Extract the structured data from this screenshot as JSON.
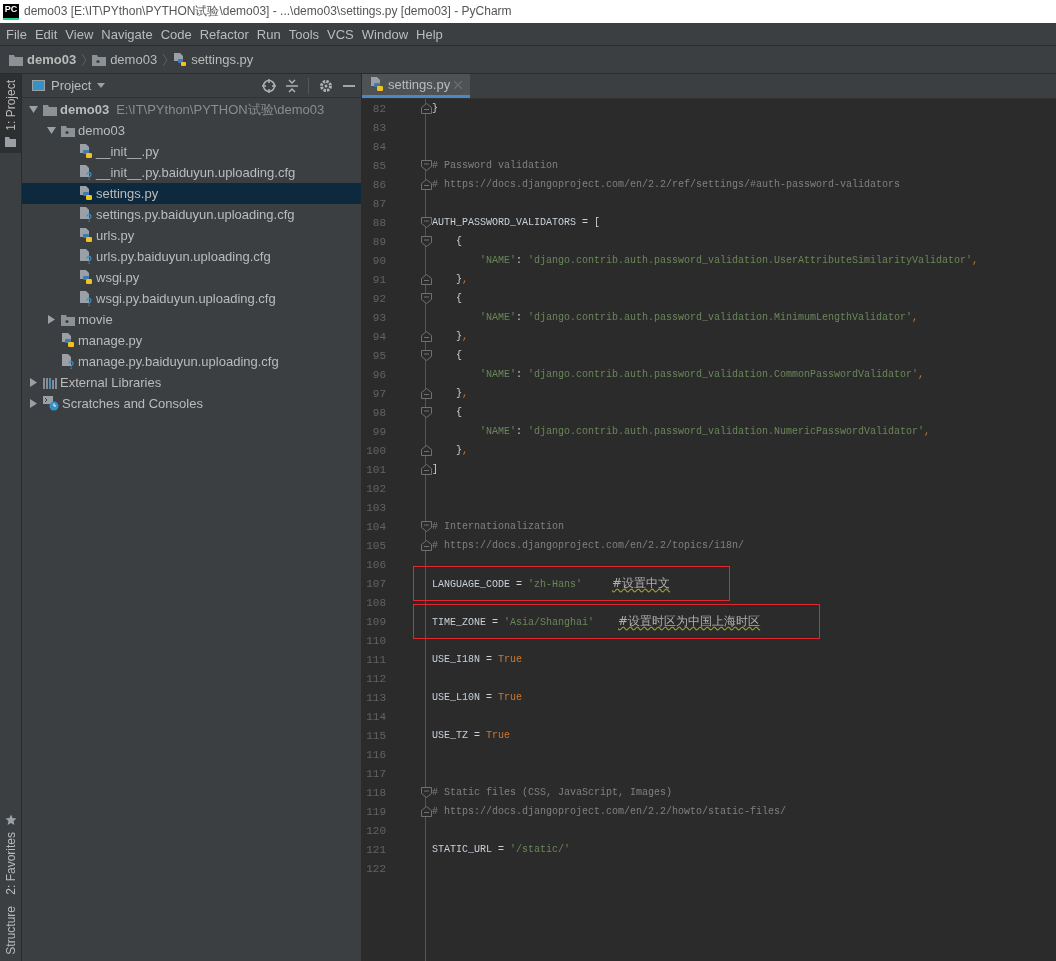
{
  "window": {
    "logo_text": "PC",
    "title": "demo03 [E:\\IT\\PYthon\\PYTHON试验\\demo03] - ...\\demo03\\settings.py [demo03] - PyCharm"
  },
  "menu": [
    "File",
    "Edit",
    "View",
    "Navigate",
    "Code",
    "Refactor",
    "Run",
    "Tools",
    "VCS",
    "Window",
    "Help"
  ],
  "breadcrumb": [
    {
      "label": "demo03",
      "kind": "folder"
    },
    {
      "label": "demo03",
      "kind": "package"
    },
    {
      "label": "settings.py",
      "kind": "python"
    }
  ],
  "side_stripe": {
    "top": [
      {
        "label": "1: Project",
        "selected": true
      }
    ],
    "bottom": [
      {
        "label": "2: Favorites",
        "selected": false
      },
      {
        "label": "Structure",
        "selected": false
      }
    ]
  },
  "project": {
    "title": "Project",
    "tree": [
      {
        "name": "demo03",
        "path": "E:\\IT\\PYthon\\PYTHON试验\\demo03",
        "kind": "folder",
        "expanded": true,
        "selected": false,
        "children": [
          {
            "name": "demo03",
            "kind": "package",
            "expanded": true,
            "selected": false,
            "children": [
              {
                "name": "__init__.py",
                "kind": "python",
                "selected": false
              },
              {
                "name": "__init__.py.baiduyun.uploading.cfg",
                "kind": "cfg",
                "selected": false
              },
              {
                "name": "settings.py",
                "kind": "python",
                "selected": true
              },
              {
                "name": "settings.py.baiduyun.uploading.cfg",
                "kind": "cfg",
                "selected": false
              },
              {
                "name": "urls.py",
                "kind": "python",
                "selected": false
              },
              {
                "name": "urls.py.baiduyun.uploading.cfg",
                "kind": "cfg",
                "selected": false
              },
              {
                "name": "wsgi.py",
                "kind": "python",
                "selected": false
              },
              {
                "name": "wsgi.py.baiduyun.uploading.cfg",
                "kind": "cfg",
                "selected": false
              }
            ]
          },
          {
            "name": "movie",
            "kind": "package",
            "expanded": false,
            "selected": false
          },
          {
            "name": "manage.py",
            "kind": "python",
            "selected": false
          },
          {
            "name": "manage.py.baiduyun.uploading.cfg",
            "kind": "cfg",
            "selected": false
          }
        ]
      },
      {
        "name": "External Libraries",
        "kind": "libraries",
        "expanded": false,
        "selected": false
      },
      {
        "name": "Scratches and Consoles",
        "kind": "scratches",
        "expanded": false,
        "selected": false
      }
    ]
  },
  "editor": {
    "tabs": [
      {
        "label": "settings.py",
        "selected": true
      }
    ],
    "lines": [
      {
        "number": "82",
        "fold": {
          "kind": "close"
        },
        "boxed": false,
        "tokens": [
          {
            "kind": "plain",
            "text": "}"
          }
        ]
      },
      {
        "number": "83",
        "boxed": false
      },
      {
        "number": "84",
        "boxed": false
      },
      {
        "number": "85",
        "fold": {
          "kind": "open"
        },
        "boxed": false,
        "tokens": [
          {
            "kind": "comment",
            "text": "# Password validation"
          }
        ]
      },
      {
        "number": "86",
        "fold": {
          "kind": "close"
        },
        "boxed": false,
        "tokens": [
          {
            "kind": "comment",
            "text": "# https://docs.djangoproject.com/en/2.2/ref/settings/#auth-password-validators"
          }
        ]
      },
      {
        "number": "87",
        "boxed": false
      },
      {
        "number": "88",
        "fold": {
          "kind": "open"
        },
        "boxed": false,
        "tokens": [
          {
            "kind": "plain",
            "text": "AUTH_PASSWORD_VALIDATORS = ["
          }
        ]
      },
      {
        "number": "89",
        "fold": {
          "kind": "open"
        },
        "boxed": false,
        "tokens": [
          {
            "kind": "plain",
            "text": "    {"
          }
        ]
      },
      {
        "number": "90",
        "boxed": false,
        "tokens": [
          {
            "kind": "string",
            "text": "        'NAME'"
          },
          {
            "kind": "plain",
            "text": ": "
          },
          {
            "kind": "string",
            "text": "'django.contrib.auth.password_validation.UserAttributeSimilarityValidator'"
          },
          {
            "kind": "keyword",
            "text": ","
          }
        ]
      },
      {
        "number": "91",
        "fold": {
          "kind": "close"
        },
        "boxed": false,
        "tokens": [
          {
            "kind": "plain",
            "text": "    }"
          },
          {
            "kind": "keyword",
            "text": ","
          }
        ]
      },
      {
        "number": "92",
        "fold": {
          "kind": "open"
        },
        "boxed": false,
        "tokens": [
          {
            "kind": "plain",
            "text": "    {"
          }
        ]
      },
      {
        "number": "93",
        "boxed": false,
        "tokens": [
          {
            "kind": "string",
            "text": "        'NAME'"
          },
          {
            "kind": "plain",
            "text": ": "
          },
          {
            "kind": "string",
            "text": "'django.contrib.auth.password_validation.MinimumLengthValidator'"
          },
          {
            "kind": "keyword",
            "text": ","
          }
        ]
      },
      {
        "number": "94",
        "fold": {
          "kind": "close"
        },
        "boxed": false,
        "tokens": [
          {
            "kind": "plain",
            "text": "    }"
          },
          {
            "kind": "keyword",
            "text": ","
          }
        ]
      },
      {
        "number": "95",
        "fold": {
          "kind": "open"
        },
        "boxed": false,
        "tokens": [
          {
            "kind": "plain",
            "text": "    {"
          }
        ]
      },
      {
        "number": "96",
        "boxed": false,
        "tokens": [
          {
            "kind": "string",
            "text": "        'NAME'"
          },
          {
            "kind": "plain",
            "text": ": "
          },
          {
            "kind": "string",
            "text": "'django.contrib.auth.password_validation.CommonPasswordValidator'"
          },
          {
            "kind": "keyword",
            "text": ","
          }
        ]
      },
      {
        "number": "97",
        "fold": {
          "kind": "close"
        },
        "boxed": false,
        "tokens": [
          {
            "kind": "plain",
            "text": "    }"
          },
          {
            "kind": "keyword",
            "text": ","
          }
        ]
      },
      {
        "number": "98",
        "fold": {
          "kind": "open"
        },
        "boxed": false,
        "tokens": [
          {
            "kind": "plain",
            "text": "    {"
          }
        ]
      },
      {
        "number": "99",
        "boxed": false,
        "tokens": [
          {
            "kind": "string",
            "text": "        'NAME'"
          },
          {
            "kind": "plain",
            "text": ": "
          },
          {
            "kind": "string",
            "text": "'django.contrib.auth.password_validation.NumericPasswordValidator'"
          },
          {
            "kind": "keyword",
            "text": ","
          }
        ]
      },
      {
        "number": "100",
        "fold": {
          "kind": "close"
        },
        "boxed": false,
        "tokens": [
          {
            "kind": "plain",
            "text": "    }"
          },
          {
            "kind": "keyword",
            "text": ","
          }
        ]
      },
      {
        "number": "101",
        "fold": {
          "kind": "close"
        },
        "boxed": false,
        "tokens": [
          {
            "kind": "plain",
            "text": "]"
          }
        ]
      },
      {
        "number": "102",
        "boxed": false
      },
      {
        "number": "103",
        "boxed": false
      },
      {
        "number": "104",
        "fold": {
          "kind": "open"
        },
        "boxed": false,
        "tokens": [
          {
            "kind": "comment",
            "text": "# Internationalization"
          }
        ]
      },
      {
        "number": "105",
        "fold": {
          "kind": "close"
        },
        "boxed": false,
        "tokens": [
          {
            "kind": "comment",
            "text": "# https://docs.djangoproject.com/en/2.2/topics/i18n/"
          }
        ]
      },
      {
        "number": "106",
        "boxed": false
      },
      {
        "number": "107",
        "boxed": true,
        "tokens": [
          {
            "kind": "plain",
            "text": "LANGUAGE_CODE = "
          },
          {
            "kind": "string",
            "text": "'zh-Hans'     "
          },
          {
            "kind": "note",
            "text": "#设置中文"
          }
        ]
      },
      {
        "number": "108",
        "boxed": false
      },
      {
        "number": "109",
        "boxed": true,
        "tokens": [
          {
            "kind": "plain",
            "text": "TIME_ZONE = "
          },
          {
            "kind": "string",
            "text": "'Asia/Shanghai'    "
          },
          {
            "kind": "note",
            "text": "#设置时区为中国上海时区"
          }
        ]
      },
      {
        "number": "110",
        "boxed": false
      },
      {
        "number": "111",
        "boxed": false,
        "tokens": [
          {
            "kind": "plain",
            "text": "USE_I18N = "
          },
          {
            "kind": "keyword",
            "text": "True"
          }
        ]
      },
      {
        "number": "112",
        "boxed": false
      },
      {
        "number": "113",
        "boxed": false,
        "tokens": [
          {
            "kind": "plain",
            "text": "USE_L10N = "
          },
          {
            "kind": "keyword",
            "text": "True"
          }
        ]
      },
      {
        "number": "114",
        "boxed": false
      },
      {
        "number": "115",
        "boxed": false,
        "tokens": [
          {
            "kind": "plain",
            "text": "USE_TZ = "
          },
          {
            "kind": "keyword",
            "text": "True"
          }
        ]
      },
      {
        "number": "116",
        "boxed": false
      },
      {
        "number": "117",
        "boxed": false
      },
      {
        "number": "118",
        "fold": {
          "kind": "open"
        },
        "boxed": false,
        "tokens": [
          {
            "kind": "comment",
            "text": "# Static files (CSS, JavaScript, Images)"
          }
        ]
      },
      {
        "number": "119",
        "fold": {
          "kind": "close"
        },
        "boxed": false,
        "tokens": [
          {
            "kind": "comment",
            "text": "# https://docs.djangoproject.com/en/2.2/howto/static-files/"
          }
        ]
      },
      {
        "number": "120",
        "boxed": false
      },
      {
        "number": "121",
        "boxed": false,
        "tokens": [
          {
            "kind": "plain",
            "text": "STATIC_URL = "
          },
          {
            "kind": "string",
            "text": "'/static/'"
          }
        ]
      },
      {
        "number": "122",
        "boxed": false
      }
    ]
  }
}
